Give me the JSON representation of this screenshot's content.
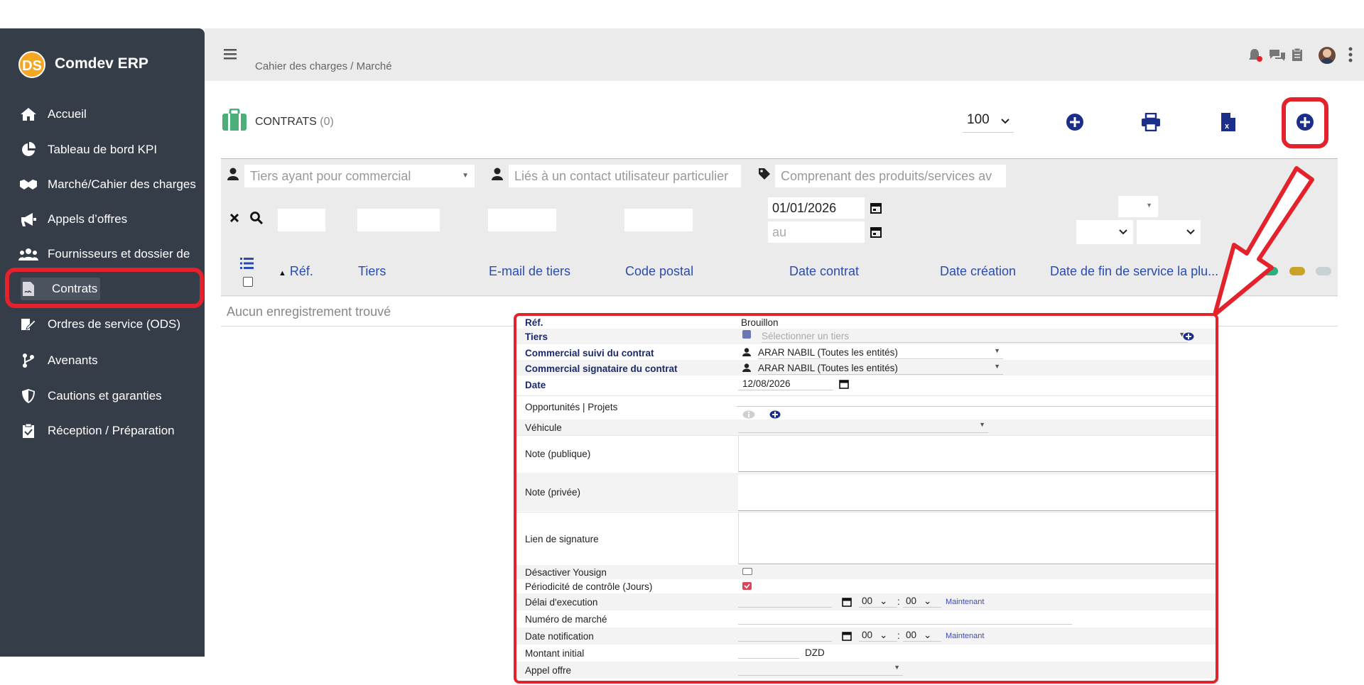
{
  "app": {
    "name": "Comdev ERP",
    "logo_text": "DS"
  },
  "sidebar": {
    "items": [
      {
        "label": "Accueil",
        "icon": "home-icon"
      },
      {
        "label": "Tableau de bord KPI",
        "icon": "pie-chart-icon"
      },
      {
        "label": "Marché/Cahier des charges",
        "icon": "handshake-icon"
      },
      {
        "label": "Appels d’offres",
        "icon": "megaphone-icon"
      },
      {
        "label": "Fournisseurs et dossier de",
        "icon": "users-icon"
      },
      {
        "label": "Contrats",
        "icon": "contract-icon"
      },
      {
        "label": "Ordres de service (ODS)",
        "icon": "edit-doc-icon"
      },
      {
        "label": "Avenants",
        "icon": "branch-icon"
      },
      {
        "label": "Cautions et garanties",
        "icon": "shield-icon"
      },
      {
        "label": "Réception / Préparation",
        "icon": "clipboard-check-icon"
      }
    ]
  },
  "header": {
    "breadcrumb": "Cahier des charges / Marché"
  },
  "list": {
    "title": "CONTRATS",
    "count": "(0)",
    "per_page": "100",
    "filters": {
      "commercial_placeholder": "Tiers ayant pour commercial",
      "contact_placeholder": "Liés à un contact utilisateur particulier",
      "products_placeholder": "Comprenant des produits/services av",
      "date_from": "01/01/2026",
      "date_to_placeholder": "au"
    },
    "columns": [
      "Réf.",
      "Tiers",
      "E-mail de tiers",
      "Code postal",
      "Date contrat",
      "Date création",
      "Date de fin de service la plu..."
    ],
    "status_dot_colors": [
      "#ffffff",
      "#2bb07f",
      "#c9a227",
      "#c8d1d3"
    ],
    "empty_message": "Aucun enregistrement trouvé"
  },
  "form": {
    "ref_label": "Réf.",
    "ref_value": "Brouillon",
    "tiers_label": "Tiers",
    "tiers_placeholder": "Sélectionner un tiers",
    "commercial_suivi_label": "Commercial suivi du contrat",
    "commercial_suivi_value": "ARAR NABIL (Toutes les entités)",
    "commercial_signataire_label": "Commercial signataire du contrat",
    "commercial_signataire_value": "ARAR NABIL (Toutes les entités)",
    "date_label": "Date",
    "date_value": "12/08/2026",
    "opportunites_label": "Opportunités | Projets",
    "vehicule_label": "Véhicule",
    "note_publique_label": "Note (publique)",
    "note_privee_label": "Note (privée)",
    "lien_signature_label": "Lien de signature",
    "desactiver_yousign_label": "Désactiver Yousign",
    "periodicite_label": "Périodicité de contrôle (Jours)",
    "delai_label": "Délai d'execution",
    "numero_marche_label": "Numéro de marché",
    "date_notification_label": "Date notification",
    "montant_label": "Montant initial",
    "currency": "DZD",
    "appel_offre_label": "Appel offre",
    "hour": "00",
    "minute": "00",
    "now_link": "Maintenant"
  }
}
